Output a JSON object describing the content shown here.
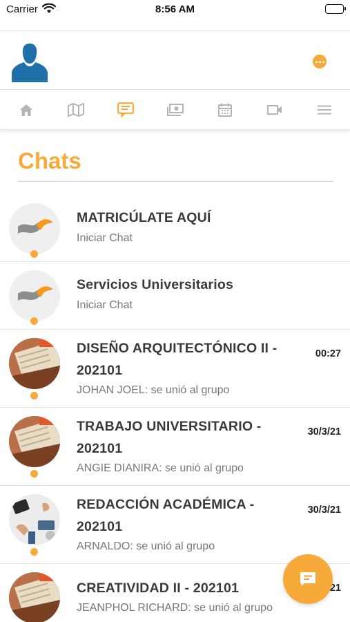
{
  "status_bar": {
    "carrier": "Carrier",
    "time": "8:56 AM"
  },
  "header": {
    "avatar_icon": "user-silhouette-icon",
    "menu_icon": "more-horizontal-icon"
  },
  "nav": [
    {
      "icon": "home-icon",
      "active": false
    },
    {
      "icon": "map-book-icon",
      "active": false
    },
    {
      "icon": "chat-icon",
      "active": true
    },
    {
      "icon": "money-icon",
      "active": false
    },
    {
      "icon": "calendar-icon",
      "active": false
    },
    {
      "icon": "video-icon",
      "active": false
    },
    {
      "icon": "menu-icon",
      "active": false
    }
  ],
  "title": "Chats",
  "chats": [
    {
      "name": "MATRICÚLATE AQUÍ",
      "preview": "Iniciar Chat",
      "time": "",
      "thumb": "logo"
    },
    {
      "name": "Servicios Universitarios",
      "preview": "Iniciar Chat",
      "time": "",
      "thumb": "logo"
    },
    {
      "name": "DISEÑO ARQUITECTÓNICO II - 202101",
      "preview": "JOHAN JOEL: se unió al grupo",
      "time": "00:27",
      "thumb": "book"
    },
    {
      "name": "TRABAJO UNIVERSITARIO - 202101",
      "preview": "ANGIE DIANIRA: se unió al grupo",
      "time": "30/3/21",
      "thumb": "book"
    },
    {
      "name": "REDACCIÓN ACADÉMICA - 202101",
      "preview": "ARNALDO: se unió al grupo",
      "time": "30/3/21",
      "thumb": "desk"
    },
    {
      "name": "CREATIVIDAD II - 202101",
      "preview": "JEANPHOL RICHARD: se unió al grupo",
      "time": "21",
      "thumb": "book"
    }
  ],
  "fab_icon": "new-chat-icon",
  "colors": {
    "accent": "#f7a93a",
    "inactive_icon": "#b5b5b5"
  }
}
